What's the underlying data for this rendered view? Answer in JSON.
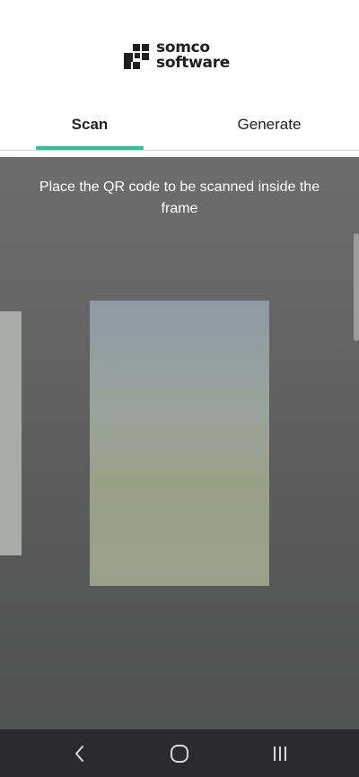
{
  "header": {
    "logo_line1": "somco",
    "logo_line2": "software",
    "logo_icon": "somco-logo-icon"
  },
  "tabs": [
    {
      "label": "Scan",
      "active": true
    },
    {
      "label": "Generate",
      "active": false
    }
  ],
  "scanner": {
    "instruction": "Place the QR code to be scanned inside the frame"
  },
  "navbar": {
    "back_icon": "back-chevron-icon",
    "home_icon": "home-circle-icon",
    "recent_icon": "recent-apps-icon"
  },
  "colors": {
    "accent": "#23c59a",
    "navbar_bg": "#2b2b2d",
    "camera_bg": "#5e5e5e"
  }
}
